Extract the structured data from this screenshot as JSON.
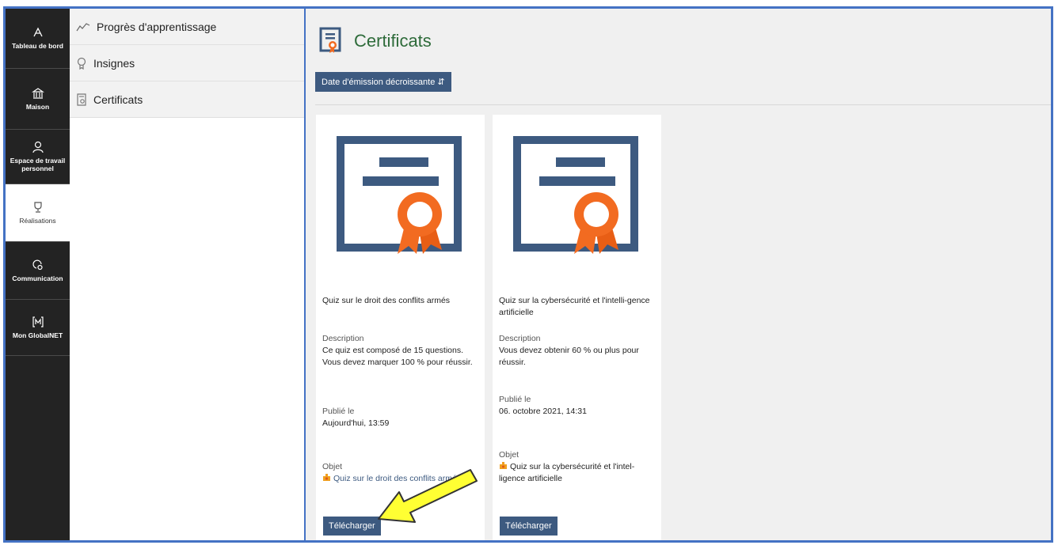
{
  "rail": {
    "items": [
      {
        "label": "Tableau de bord",
        "icon": "dashboard-icon"
      },
      {
        "label": "Maison",
        "icon": "bank-icon"
      },
      {
        "label": "Espace de travail personnel",
        "icon": "user-icon"
      },
      {
        "label": "Réalisations",
        "icon": "trophy-icon"
      },
      {
        "label": "Communication",
        "icon": "chat-icon"
      },
      {
        "label": "Mon GlobalNET",
        "icon": "m-box-icon"
      }
    ]
  },
  "subnav": {
    "items": [
      {
        "label": "Progrès d'apprentissage",
        "icon": "chart-line-icon"
      },
      {
        "label": "Insignes",
        "icon": "badge-icon"
      },
      {
        "label": "Certificats",
        "icon": "certificate-icon"
      }
    ]
  },
  "main": {
    "title": "Certificats",
    "sort_label": "Date d'émission décroissante ⇵"
  },
  "cards": [
    {
      "title": "Quiz sur le droit des conflits armés",
      "description_label": "Description",
      "description": "Ce quiz est composé de 15 questions. Vous devez marquer 100 % pour réussir.",
      "published_label": "Publié le",
      "published": "Aujourd'hui, 13:59",
      "object_label": "Objet",
      "object": "Quiz sur le droit des conflits armés",
      "download_label": "Télécharger"
    },
    {
      "title": "Quiz sur la cybersécurité et l'intelli-gence artificielle",
      "description_label": "Description",
      "description": "Vous devez obtenir 60 % ou plus pour réussir.",
      "published_label": "Publié le",
      "published": "06. octobre 2021, 14:31",
      "object_label": "Objet",
      "object": "Quiz sur la cybersécurité et l'intel-ligence artificielle",
      "download_label": "Télécharger"
    }
  ],
  "colors": {
    "rail_bg": "#232323",
    "accent": "#3d5a80",
    "title_green": "#2e6b3a",
    "ribbon_orange": "#f26b21",
    "annotation_arrow": "#ffff33"
  }
}
